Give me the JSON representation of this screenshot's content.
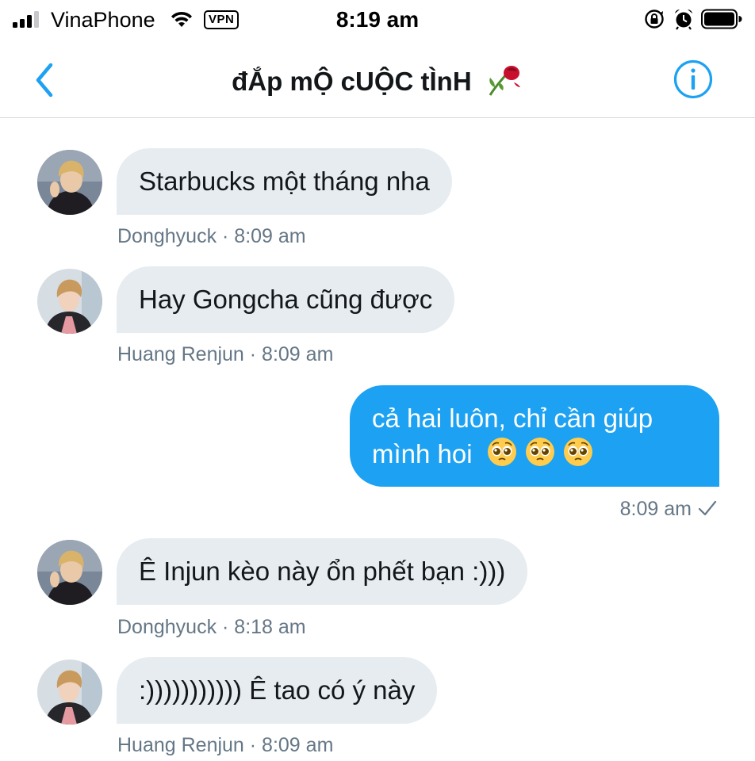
{
  "status_bar": {
    "carrier": "VinaPhone",
    "vpn": "VPN",
    "time": "8:19 am",
    "icons": [
      "signal-icon",
      "wifi-icon",
      "vpn-badge",
      "orientation-lock-icon",
      "alarm-icon",
      "battery-icon"
    ]
  },
  "nav": {
    "title": "đẮp mỘ cUỘC tÌnH",
    "back_icon": "chevron-left-icon",
    "info_icon": "info-icon",
    "title_emoji": "wilted-rose-icon"
  },
  "messages": [
    {
      "direction": "incoming",
      "text": "Starbucks một tháng nha",
      "meta": "Donghyuck · 8:09 am",
      "sender": "Donghyuck"
    },
    {
      "direction": "incoming",
      "text": "Hay Gongcha cũng được",
      "meta": "Huang Renjun · 8:09 am",
      "sender": "Huang Renjun"
    },
    {
      "direction": "outgoing",
      "line1": "cả hai luôn, chỉ cần giúp",
      "line2": "mình hoi",
      "emojis": [
        "pleading-face-icon",
        "pleading-face-icon",
        "pleading-face-icon"
      ],
      "meta": "8:09 am",
      "status_icon": "check-icon"
    },
    {
      "direction": "incoming",
      "text": "Ê Injun kèo này ổn phết bạn :)))",
      "meta": "Donghyuck · 8:18 am",
      "sender": "Donghyuck"
    },
    {
      "direction": "incoming",
      "text": ":))))))))))) Ê tao có ý này",
      "meta": "Huang Renjun · 8:09 am",
      "sender": "Huang Renjun"
    }
  ],
  "colors": {
    "accent": "#1da1f2",
    "incoming_bubble": "#e6ecf0",
    "meta_text": "#657786",
    "divider": "#d6d9db"
  }
}
